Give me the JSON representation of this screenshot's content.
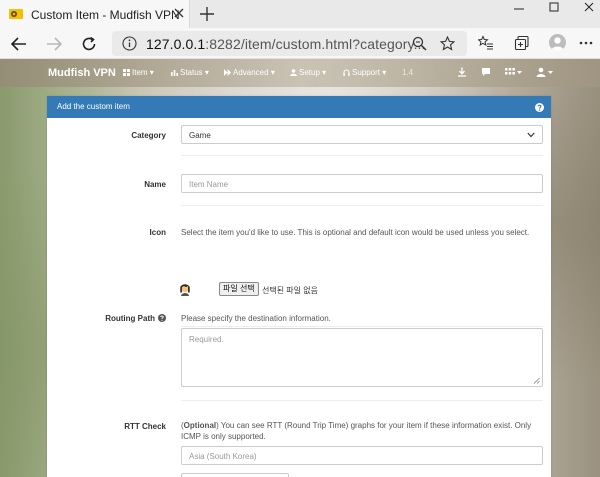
{
  "browser": {
    "tab_title": "Custom Item - Mudfish VPN",
    "url_host": "127.0.0.1",
    "url_rest": ":8282/item/custom.html?category..."
  },
  "navbar": {
    "brand": "Mudfish VPN",
    "items": [
      {
        "label": "Item",
        "icon": "th-large-icon"
      },
      {
        "label": "Status",
        "icon": "bar-chart-icon"
      },
      {
        "label": "Advanced",
        "icon": "forward-icon"
      },
      {
        "label": "Setup",
        "icon": "user-icon"
      },
      {
        "label": "Support",
        "icon": "headphones-icon"
      }
    ],
    "extra_text": "1.4"
  },
  "card": {
    "title": "Add the custom item",
    "category": {
      "label": "Category",
      "value": "Game"
    },
    "name": {
      "label": "Name",
      "placeholder": "Item Name"
    },
    "icon": {
      "label": "Icon",
      "hint": "Select the item you'd like to use. This is optional and default icon would be used unless you select.",
      "file_button": "파일 선택",
      "file_status": "선택된 파일 없음"
    },
    "routing_path": {
      "label": "Routing Path",
      "hint": "Please specify the destination information.",
      "placeholder": "Required."
    },
    "rtt_check": {
      "label": "RTT Check",
      "hint_bold": "Optional",
      "hint_rest": " You can see RTT (Round Trip Time) graphs for your item if these information exist. Only ICMP is only supported.",
      "placeholder": "Asia (South Korea)"
    }
  },
  "colors": {
    "card_header": "#337ab7",
    "tab_active": "#f7f7f7"
  }
}
